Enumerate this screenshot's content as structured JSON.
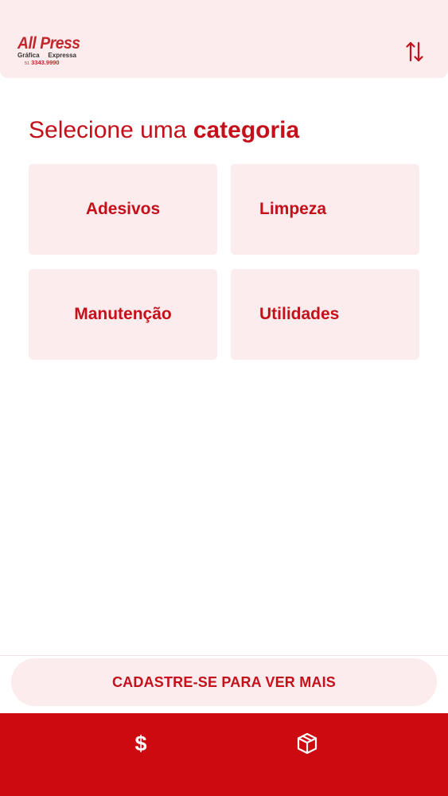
{
  "header": {
    "logo": {
      "name": "All Press",
      "tagline_left": "Gráfica",
      "tagline_right": "Expressa",
      "phone_prefix": "51",
      "phone": "3343.9990"
    },
    "sort_icon": "swap-vertical-icon"
  },
  "main": {
    "title_light": "Selecione uma",
    "title_bold": "categoria",
    "categories": [
      {
        "label": "Adesivos"
      },
      {
        "label": "Limpeza"
      },
      {
        "label": "Manutenção"
      },
      {
        "label": "Utilidades"
      }
    ]
  },
  "register": {
    "label": "CADASTRE-SE PARA VER MAIS"
  },
  "bottom_nav": {
    "items": [
      {
        "icon": "dollar-icon",
        "glyph": "$"
      },
      {
        "icon": "package-icon"
      }
    ]
  },
  "colors": {
    "brand_red": "#cc0a10",
    "text_red": "#c4101a",
    "light_pink": "#fdeced"
  }
}
